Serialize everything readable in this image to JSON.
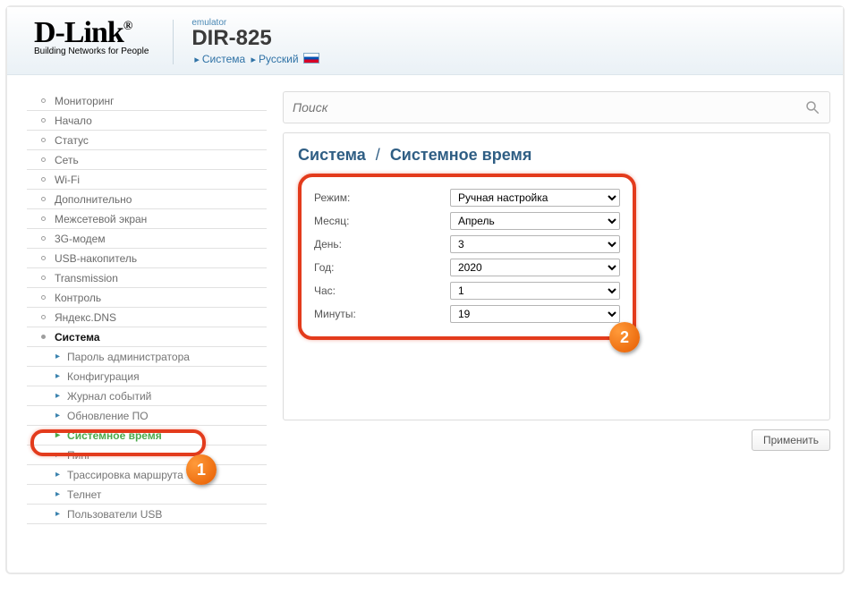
{
  "header": {
    "brand": "D-Link",
    "tagline": "Building Networks for People",
    "emulator": "emulator",
    "model": "DIR-825",
    "crumbs": {
      "system": "Система",
      "lang": "Русский"
    }
  },
  "search": {
    "placeholder": "Поиск"
  },
  "sidebar": {
    "items": [
      "Мониторинг",
      "Начало",
      "Статус",
      "Сеть",
      "Wi-Fi",
      "Дополнительно",
      "Межсетевой экран",
      "3G-модем",
      "USB-накопитель",
      "Transmission",
      "Контроль",
      "Яндекс.DNS",
      "Система"
    ],
    "sub": [
      "Пароль администратора",
      "Конфигурация",
      "Журнал событий",
      "Обновление ПО",
      "Системное время",
      "Пинг",
      "Трассировка маршрута",
      "Телнет",
      "Пользователи USB"
    ]
  },
  "page": {
    "title_a": "Система",
    "sep": "/",
    "title_b": "Системное время",
    "fields": {
      "mode": {
        "label": "Режим:",
        "value": "Ручная настройка"
      },
      "month": {
        "label": "Месяц:",
        "value": "Апрель"
      },
      "day": {
        "label": "День:",
        "value": "3"
      },
      "year": {
        "label": "Год:",
        "value": "2020"
      },
      "hour": {
        "label": "Час:",
        "value": "1"
      },
      "min": {
        "label": "Минуты:",
        "value": "19"
      }
    },
    "apply": "Применить"
  },
  "callouts": {
    "one": "1",
    "two": "2"
  }
}
